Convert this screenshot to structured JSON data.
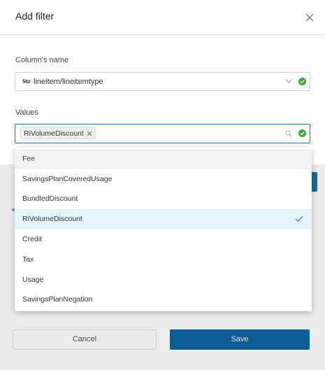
{
  "dialog": {
    "title": "Add filter"
  },
  "column_field": {
    "label": "Column's name",
    "type_icon": "Str",
    "value": "lineitem/lineitemtype"
  },
  "values_field": {
    "label": "Values",
    "chips": [
      "RiVolumeDiscount"
    ]
  },
  "dropdown": {
    "options": [
      {
        "label": "Fee",
        "state": "hovered"
      },
      {
        "label": "SavingsPlanCoveredUsage",
        "state": ""
      },
      {
        "label": "BundledDiscount",
        "state": ""
      },
      {
        "label": "RiVolumeDiscount",
        "state": "selected"
      },
      {
        "label": "Credit",
        "state": ""
      },
      {
        "label": "Tax",
        "state": ""
      },
      {
        "label": "Usage",
        "state": ""
      },
      {
        "label": "SavingsPlanNegation",
        "state": ""
      }
    ]
  },
  "footer": {
    "cancel_label": "Cancel",
    "save_label": "Save"
  },
  "colors": {
    "accent": "#0d5c97",
    "valid": "#3aaa35",
    "selected_row": "#e5f3fb"
  },
  "icons": [
    "close-icon",
    "chevron-down-icon",
    "search-icon",
    "check-circle-icon",
    "remove-chip-icon",
    "checkmark-icon"
  ]
}
